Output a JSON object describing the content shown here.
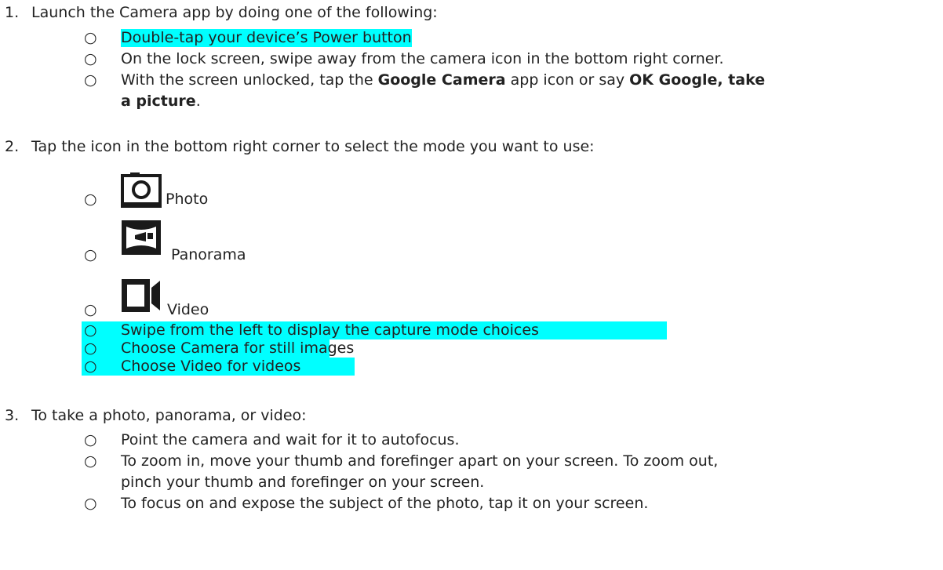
{
  "steps": [
    {
      "number": "1.",
      "text": "Launch the Camera app by doing one of the following:",
      "bullets": [
        {
          "text": "Double-tap your device’s Power button"
        },
        {
          "text": "On the lock screen, swipe away from the camera icon in the bottom right corner."
        },
        {
          "pre": "With the screen unlocked, tap the ",
          "bold1": "Google Camera",
          "mid": " app icon or say ",
          "bold2": "OK Google, take",
          "bold3": "a picture",
          "post": "."
        }
      ]
    },
    {
      "number": "2.",
      "text": "Tap the icon in the bottom right corner to select the mode you want to use:",
      "modes": [
        {
          "label": "Photo",
          "icon": "camera-icon"
        },
        {
          "label": "Panorama",
          "icon": "panorama-icon"
        },
        {
          "label": "Video",
          "icon": "video-icon"
        }
      ],
      "bullets": [
        {
          "text": "Swipe from the left to display the capture mode choices"
        },
        {
          "text": "Choose Camera for still images"
        },
        {
          "text": "Choose Video for videos"
        }
      ]
    },
    {
      "number": "3.",
      "text": "To take a photo, panorama, or video:",
      "bullets": [
        {
          "text": "Point the camera and wait for it to autofocus."
        },
        {
          "text": "To zoom in, move your thumb and forefinger apart on your screen. To zoom out,",
          "text2": "pinch your thumb and forefinger on your screen."
        },
        {
          "text": "To focus on and expose the subject of the photo, tap it on your screen."
        }
      ]
    }
  ],
  "bullet_glyph": "○",
  "highlight_color": "#00ffff"
}
